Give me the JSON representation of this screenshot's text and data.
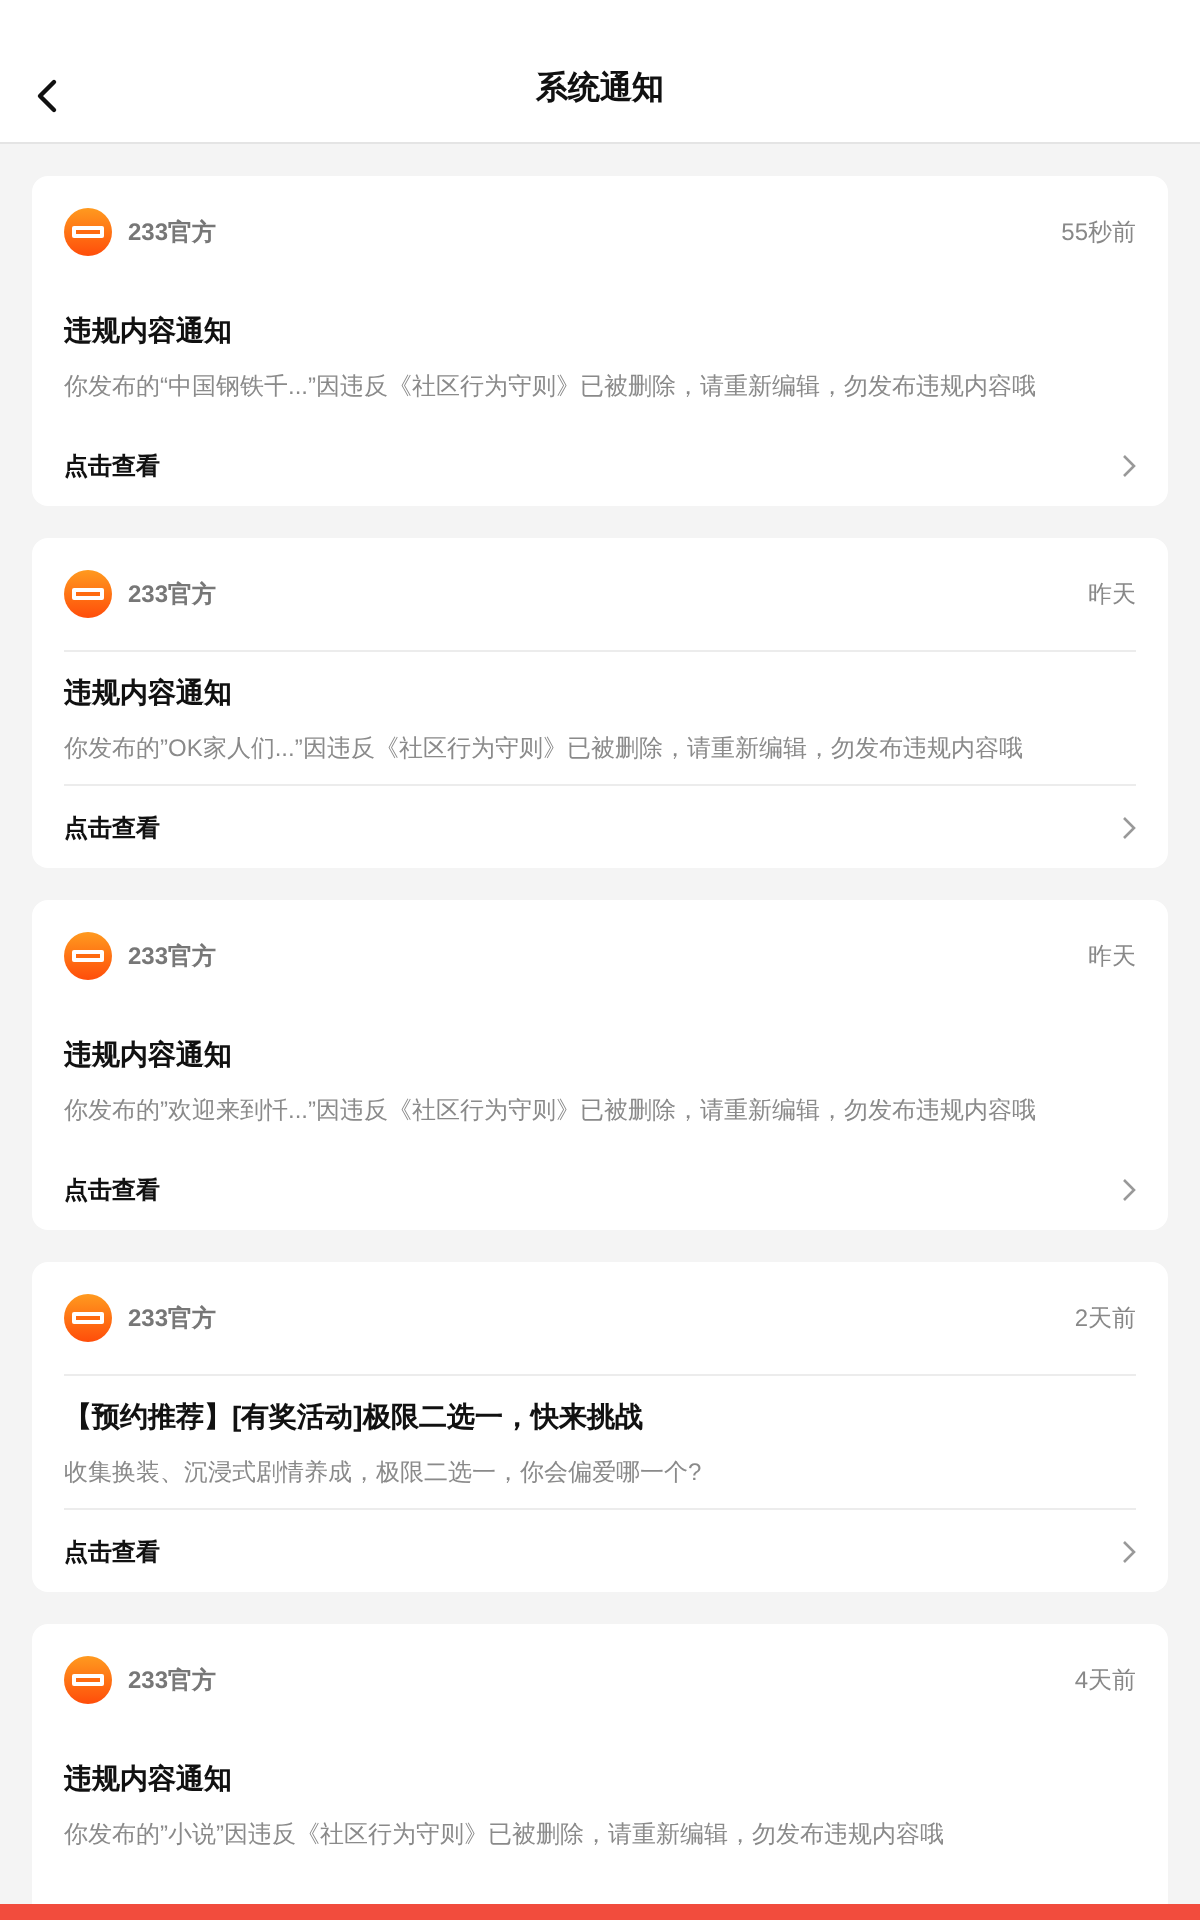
{
  "header": {
    "title": "系统通知"
  },
  "notices": [
    {
      "sender": "233官方",
      "time": "55秒前",
      "title": "违规内容通知",
      "body": "你发布的“中国钢铁千...”因违反《社区行为守则》已被删除，请重新编辑，勿发布违规内容哦",
      "link": "点击查看",
      "dividers": false
    },
    {
      "sender": "233官方",
      "time": "昨天",
      "title": "违规内容通知",
      "body": "你发布的”OK家人们...”因违反《社区行为守则》已被删除，请重新编辑，勿发布违规内容哦",
      "link": "点击查看",
      "dividers": true
    },
    {
      "sender": "233官方",
      "time": "昨天",
      "title": "违规内容通知",
      "body": "你发布的”欢迎来到忏...”因违反《社区行为守则》已被删除，请重新编辑，勿发布违规内容哦",
      "link": "点击查看",
      "dividers": false
    },
    {
      "sender": "233官方",
      "time": "2天前",
      "title": "【预约推荐】[有奖活动]极限二选一，快来挑战",
      "body": "收集换装、沉浸式剧情养成，极限二选一，你会偏爱哪一个?",
      "link": "点击查看",
      "dividers": true
    },
    {
      "sender": "233官方",
      "time": "4天前",
      "title": "违规内容通知",
      "body": "你发布的”小说”因违反《社区行为守则》已被删除，请重新编辑，勿发布违规内容哦",
      "dividers": false
    }
  ]
}
